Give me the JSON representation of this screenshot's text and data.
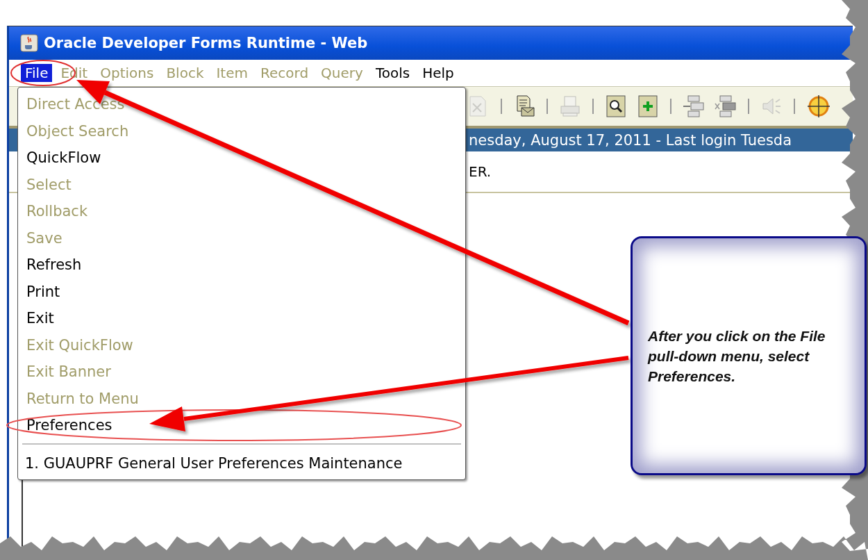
{
  "window": {
    "title": "Oracle Developer Forms Runtime - Web"
  },
  "menu_bar": [
    {
      "label": "File",
      "selected": true,
      "disabled": false
    },
    {
      "label": "Edit",
      "selected": false,
      "disabled": true
    },
    {
      "label": "Options",
      "selected": false,
      "disabled": true
    },
    {
      "label": "Block",
      "selected": false,
      "disabled": true
    },
    {
      "label": "Item",
      "selected": false,
      "disabled": true
    },
    {
      "label": "Record",
      "selected": false,
      "disabled": true
    },
    {
      "label": "Query",
      "selected": false,
      "disabled": true
    },
    {
      "label": "Tools",
      "selected": false,
      "disabled": false
    },
    {
      "label": "Help",
      "selected": false,
      "disabled": false
    }
  ],
  "toolbar": [
    {
      "kind": "delete-doc",
      "disabled": true
    },
    {
      "kind": "separator"
    },
    {
      "kind": "mail-doc",
      "disabled": false
    },
    {
      "kind": "separator"
    },
    {
      "kind": "printer",
      "disabled": true
    },
    {
      "kind": "separator"
    },
    {
      "kind": "search-doc",
      "disabled": false
    },
    {
      "kind": "add-doc",
      "disabled": false
    },
    {
      "kind": "separator"
    },
    {
      "kind": "block-in",
      "disabled": false
    },
    {
      "kind": "block-out",
      "disabled": false
    },
    {
      "kind": "separator"
    },
    {
      "kind": "speaker",
      "disabled": true
    },
    {
      "kind": "separator"
    },
    {
      "kind": "target",
      "disabled": false
    }
  ],
  "banner": "nesday, August 17, 2011 - Last login Tuesda",
  "message": "ER.",
  "file_menu": {
    "items": [
      {
        "label": "Direct Access",
        "disabled": true
      },
      {
        "label": "Object Search",
        "disabled": true
      },
      {
        "label": "QuickFlow",
        "disabled": false
      },
      {
        "label": "Select",
        "disabled": true
      },
      {
        "label": "Rollback",
        "disabled": true
      },
      {
        "label": "Save",
        "disabled": true
      },
      {
        "label": "Refresh",
        "disabled": false
      },
      {
        "label": "Print",
        "disabled": false
      },
      {
        "label": "Exit",
        "disabled": false
      },
      {
        "label": "Exit QuickFlow",
        "disabled": true
      },
      {
        "label": "Exit Banner",
        "disabled": true
      },
      {
        "label": "Return to Menu",
        "disabled": true
      },
      {
        "label": "Preferences",
        "disabled": false
      }
    ],
    "recent": [
      "1. GUAUPRF General User Preferences Maintenance"
    ]
  },
  "callout": {
    "text": "After you click on the File pull-down menu, select Preferences."
  }
}
